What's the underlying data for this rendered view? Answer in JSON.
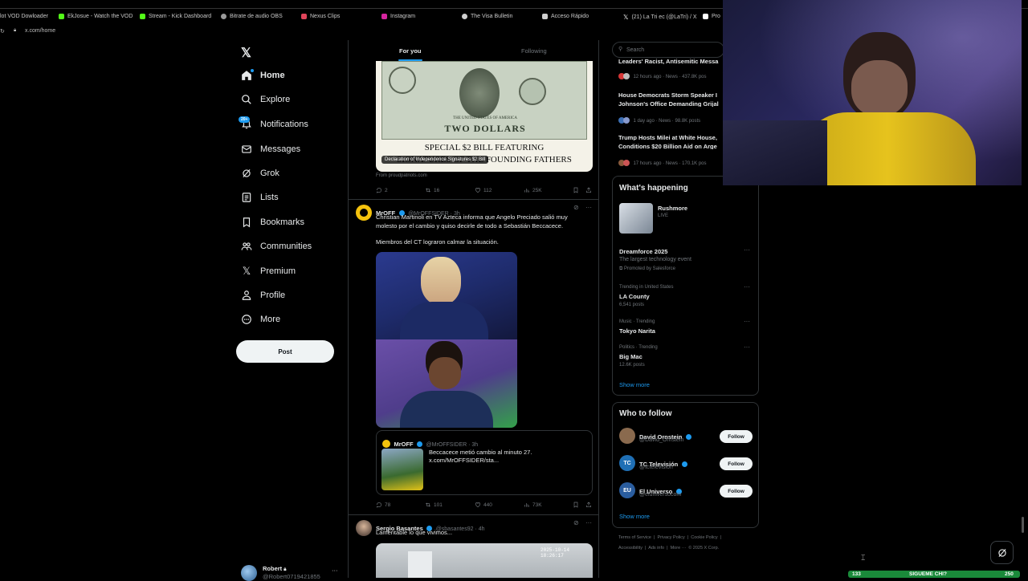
{
  "bookmarks": [
    {
      "label": "lot VOD Dowloader",
      "color": "#7f7f7f"
    },
    {
      "label": "EkJosue - Watch the VOD",
      "color": "#53fc18"
    },
    {
      "label": "Stream - Kick Dashboard",
      "color": "#53fc18"
    },
    {
      "label": "Bitrate de audio OBS",
      "color": "#9a9a9a"
    },
    {
      "label": "Nexus Clips",
      "color": "#e0445a"
    },
    {
      "label": "Instagram",
      "color": "#d6249f"
    },
    {
      "label": "The Visa Bulletin",
      "color": "#cfcfcf"
    },
    {
      "label": "Acceso Rápido",
      "color": "#cfcfcf"
    },
    {
      "label": "(21) La Tri ec (@LaTri) / X",
      "color": "#ffffff"
    },
    {
      "label": "Pro",
      "color": "#ffffff"
    }
  ],
  "address": {
    "url": "x.com/home"
  },
  "sidebar": {
    "items": [
      {
        "label": "Home",
        "icon": "home-icon"
      },
      {
        "label": "Explore",
        "icon": "search-icon"
      },
      {
        "label": "Notifications",
        "icon": "bell-icon",
        "badge": "20+"
      },
      {
        "label": "Messages",
        "icon": "mail-icon"
      },
      {
        "label": "Grok",
        "icon": "grok-icon"
      },
      {
        "label": "Lists",
        "icon": "list-icon"
      },
      {
        "label": "Bookmarks",
        "icon": "bookmark-icon"
      },
      {
        "label": "Communities",
        "icon": "communities-icon"
      },
      {
        "label": "Premium",
        "icon": "x-logo-icon"
      },
      {
        "label": "Profile",
        "icon": "person-icon"
      },
      {
        "label": "More",
        "icon": "more-circle-icon"
      }
    ],
    "post_label": "Post",
    "user": {
      "name": "Robert",
      "handle": "@Robert0719421855"
    }
  },
  "feed": {
    "tabs": {
      "for_you": "For you",
      "following": "Following"
    },
    "tweet1": {
      "image_headline": "SPECIAL $2 BILL FEATURING",
      "image_sub": "SIGNATURES OF THE FOUNDING FATHERS",
      "image_caption": "Declaration of Independence Signatures $2 Bill",
      "bill_text": "TWO DOLLARS",
      "bill_country": "THE UNITED STATES OF AMERICA",
      "source": "From proudpatriots.com",
      "replies": "2",
      "reposts": "16",
      "likes": "112",
      "views": "25K"
    },
    "tweet2": {
      "name": "MrOFF",
      "handle": "@MrOFFSIDER · 3h",
      "text1": "Christian Martinoli en TV Azteca informa que Angelo Preciado salió muy molesto por el cambio y quiso decirle de todo a Sebastián Beccacece.",
      "text2": "Miembros del CT lograron calmar la situación.",
      "quote": {
        "name": "MrOFF",
        "handle": "@MrOFFSIDER · 3h",
        "text": "Beccacece metió cambio al minuto 27.",
        "link": "x.com/MrOFFSIDER/sta..."
      },
      "replies": "78",
      "reposts": "101",
      "likes": "440",
      "views": "73K"
    },
    "tweet3": {
      "name": "Sergio Basantes",
      "handle": "@sbasantes92 · 4h",
      "text": "Lamentable lo que vivimos...",
      "timestamp": "2025-10-14 18:26:17"
    }
  },
  "right": {
    "search_placeholder": "Search",
    "news": [
      {
        "title": "Leaders' Racist, Antisemitic Messa",
        "meta": "12 hours ago · News · 437.8K pos"
      },
      {
        "title": "House Democrats Storm Speaker I",
        "title2": "Johnson's Office Demanding Grijal",
        "meta": "1 day ago · News · 98.8K posts"
      },
      {
        "title": "Trump Hosts Milei at White House,",
        "title2": "Conditions $20 Billion Aid on Arge",
        "meta": "17 hours ago · News · 170.1K pos"
      }
    ],
    "happening": {
      "title": "What's happening",
      "live": {
        "name": "Rushmore",
        "status": "LIVE"
      },
      "promo": {
        "title": "Dreamforce 2025",
        "desc": "The largest technology event",
        "by": "Promoted by Salesforce"
      },
      "trends": [
        {
          "context": "Trending in United States",
          "name": "LA County",
          "posts": "6,541 posts"
        },
        {
          "context": "Music · Trending",
          "name": "Tokyo Narita",
          "posts": ""
        },
        {
          "context": "Politics · Trending",
          "name": "Big Mac",
          "posts": "12.6K posts"
        }
      ],
      "show_more": "Show more"
    },
    "who": {
      "title": "Who to follow",
      "people": [
        {
          "name": "David Ornstein",
          "handle": "@David_Ornstein",
          "color": "#8a6a4e"
        },
        {
          "name": "TC Televisión",
          "handle": "@tctelevision",
          "color": "#1f6fb5"
        },
        {
          "name": "El Universo",
          "handle": "@eluniversocom",
          "color": "#2a5d9f"
        }
      ],
      "follow_label": "Follow",
      "show_more": "Show more"
    },
    "footer": {
      "line1": "Terms of Service  |  Privacy Policy  |  Cookie Policy  |",
      "line2": "Accessibility  |  Ads info  |  More ···  © 2025 X Corp."
    }
  },
  "overlay": {
    "left_num": "133",
    "center": "SIGUEME CHI?",
    "right_num": "250"
  }
}
